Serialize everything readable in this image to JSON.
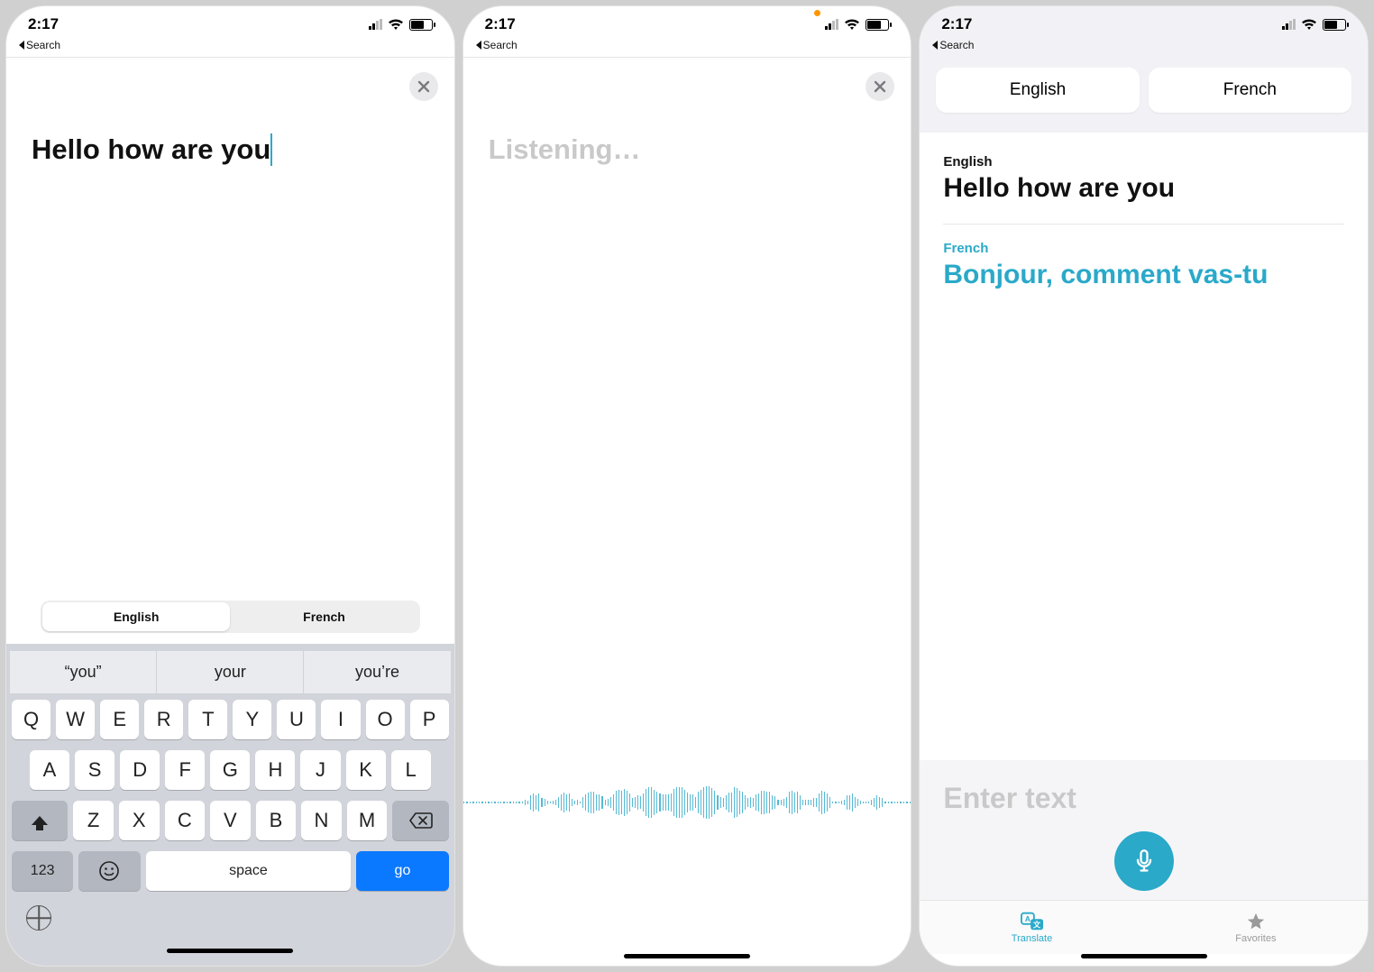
{
  "screen1": {
    "statusTime": "2:17",
    "backLabel": "Search",
    "inputText": "Hello how are you",
    "segEnglish": "English",
    "segFrench": "French",
    "suggestions": [
      "“you”",
      "your",
      "you’re"
    ],
    "row1": [
      "Q",
      "W",
      "E",
      "R",
      "T",
      "Y",
      "U",
      "I",
      "O",
      "P"
    ],
    "row2": [
      "A",
      "S",
      "D",
      "F",
      "G",
      "H",
      "J",
      "K",
      "L"
    ],
    "row3": [
      "Z",
      "X",
      "C",
      "V",
      "B",
      "N",
      "M"
    ],
    "numKey": "123",
    "spaceKey": "space",
    "goKey": "go"
  },
  "screen2": {
    "statusTime": "2:17",
    "backLabel": "Search",
    "listeningText": "Listening…"
  },
  "screen3": {
    "statusTime": "2:17",
    "backLabel": "Search",
    "pillEnglish": "English",
    "pillFrench": "French",
    "srcLabel": "English",
    "srcText": "Hello how are you",
    "tgtLabel": "French",
    "tgtText": "Bonjour, comment vas-tu",
    "enterPlaceholder": "Enter text",
    "tabTranslate": "Translate",
    "tabFavorites": "Favorites"
  }
}
